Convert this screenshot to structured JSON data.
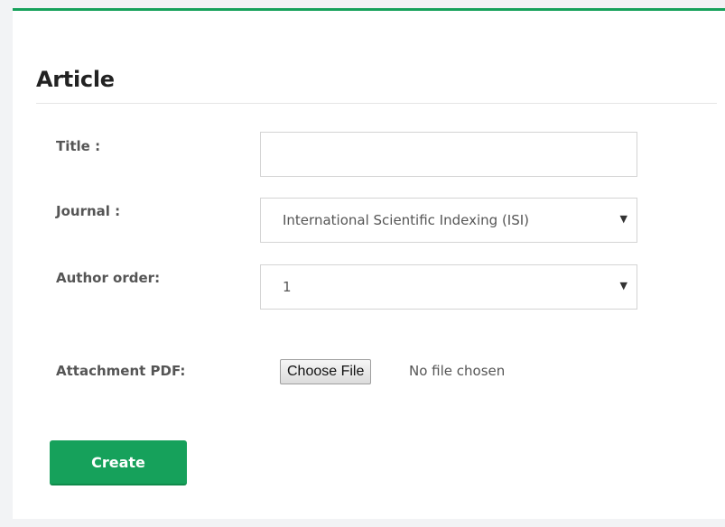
{
  "form": {
    "heading": "Article",
    "fields": {
      "title": {
        "label": "Title :",
        "value": ""
      },
      "journal": {
        "label": "Journal :",
        "selected": "International Scientific Indexing (ISI)"
      },
      "author_order": {
        "label": "Author order:",
        "selected": "1"
      },
      "attachment": {
        "label": "Attachment PDF:",
        "button_label": "Choose File",
        "status": "No file chosen"
      }
    },
    "submit_label": "Create"
  },
  "icons": {
    "dropdown": "chevron-down-icon"
  },
  "colors": {
    "accent": "#16a15b",
    "border": "#d4d4d4"
  }
}
